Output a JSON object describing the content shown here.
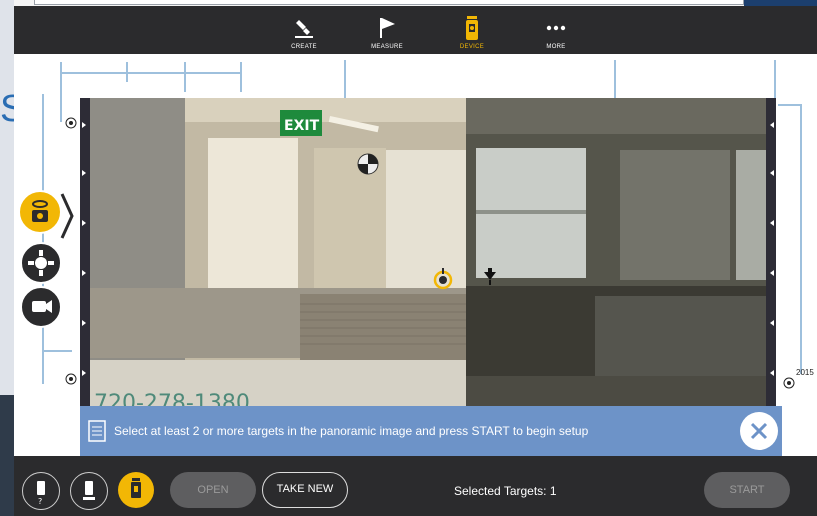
{
  "background": {
    "partial_letter": "S"
  },
  "toolbar": {
    "items": [
      {
        "label": "CREATE",
        "icon": "pencil-icon"
      },
      {
        "label": "MEASURE",
        "icon": "flag-icon"
      },
      {
        "label": "DEVICE",
        "icon": "total-station-icon"
      },
      {
        "label": "MORE",
        "icon": "more-dots-icon"
      }
    ],
    "active": "DEVICE",
    "accent": "#f2b705"
  },
  "panorama": {
    "exit_sign": "EXIT",
    "whiteboard_text": "720-278-1380"
  },
  "blueprint": {
    "corner_label": "2015"
  },
  "hint": {
    "text": "Select at least 2 or more targets in the panoramic image and press START to begin setup"
  },
  "bottom": {
    "open_label": "OPEN",
    "take_new_label": "TAKE NEW",
    "selected_targets": "Selected Targets: 1",
    "start_label": "START"
  },
  "colors": {
    "hint_bg": "#6d93c8",
    "bar_bg": "#2b2b2d",
    "accent": "#f2b705"
  }
}
